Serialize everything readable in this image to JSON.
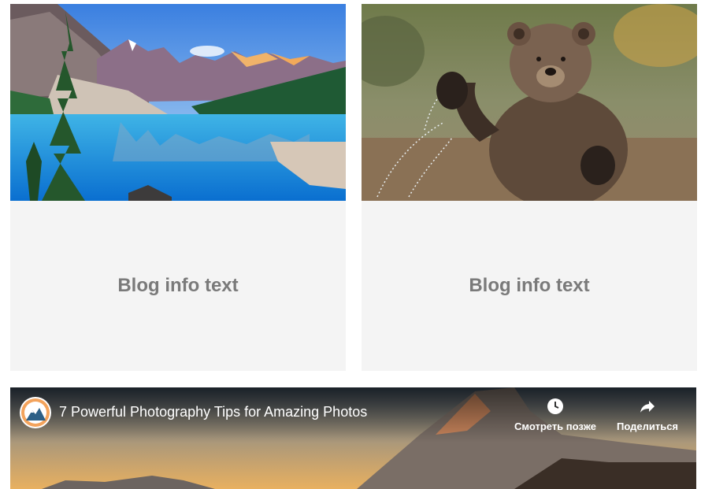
{
  "cards": [
    {
      "image_alt": "mountain-lake-landscape",
      "info_text": "Blog info text"
    },
    {
      "image_alt": "waving-bear",
      "info_text": "Blog info text"
    }
  ],
  "video": {
    "title": "7 Powerful Photography Tips for Amazing Photos",
    "watch_later_label": "Смотреть позже",
    "share_label": "Поделиться",
    "watch_later_icon": "clock-icon",
    "share_icon": "share-arrow-icon"
  },
  "colors": {
    "card_background": "#f4f4f4",
    "info_text": "#7a7a7a",
    "overlay_text": "#ffffff"
  }
}
